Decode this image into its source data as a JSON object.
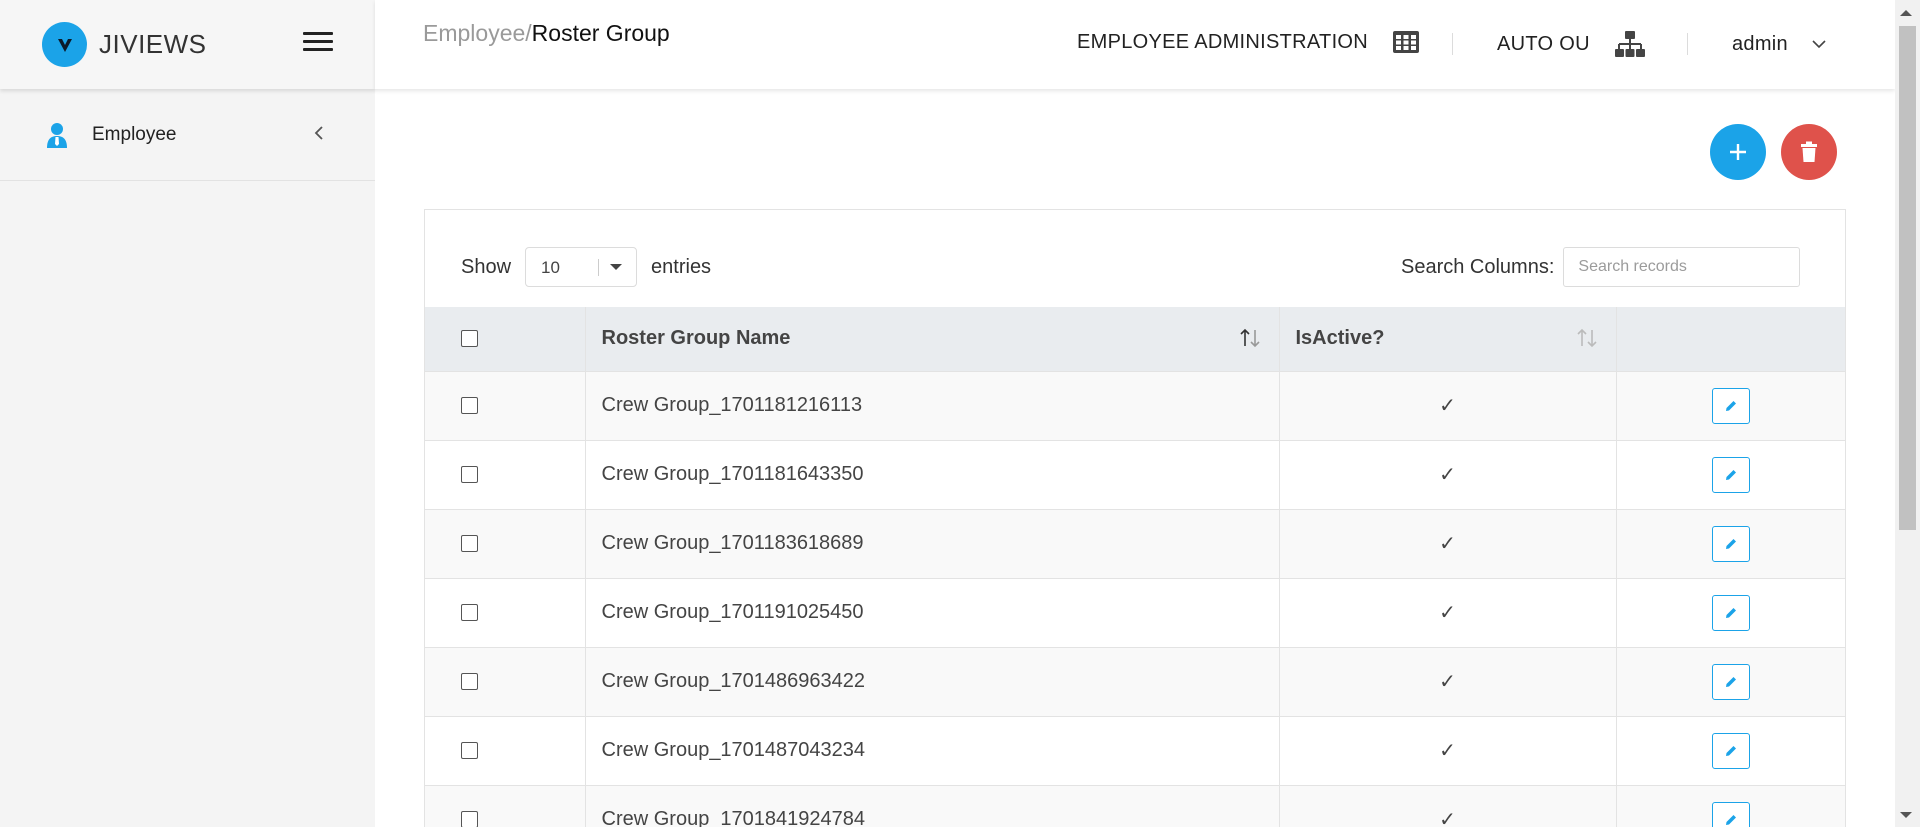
{
  "brand": {
    "name": "JIVIEWS",
    "logo_letter": "V",
    "accent": "#1ba3e8"
  },
  "sidebar": {
    "items": [
      {
        "label": "Employee",
        "icon": "user-tie-icon"
      }
    ]
  },
  "breadcrumb": {
    "parent": "Employee/",
    "current": "Roster Group"
  },
  "header": {
    "module": "EMPLOYEE ADMINISTRATION",
    "org": "AUTO OU",
    "user": "admin"
  },
  "actions": {
    "add_color": "#1ba3e8",
    "delete_color": "#df524b"
  },
  "table_controls": {
    "show_label": "Show",
    "entries_value": "10",
    "entries_label": "entries",
    "search_label": "Search Columns:",
    "search_placeholder": "Search records"
  },
  "table": {
    "columns": [
      "Roster Group Name",
      "IsActive?"
    ],
    "rows": [
      {
        "name": "Crew Group_1701181216113",
        "active": "✓"
      },
      {
        "name": "Crew Group_1701181643350",
        "active": "✓"
      },
      {
        "name": "Crew Group_1701183618689",
        "active": "✓"
      },
      {
        "name": "Crew Group_1701191025450",
        "active": "✓"
      },
      {
        "name": "Crew Group_1701486963422",
        "active": "✓"
      },
      {
        "name": "Crew Group_1701487043234",
        "active": "✓"
      },
      {
        "name": "Crew Group_1701841924784",
        "active": "✓"
      }
    ]
  }
}
